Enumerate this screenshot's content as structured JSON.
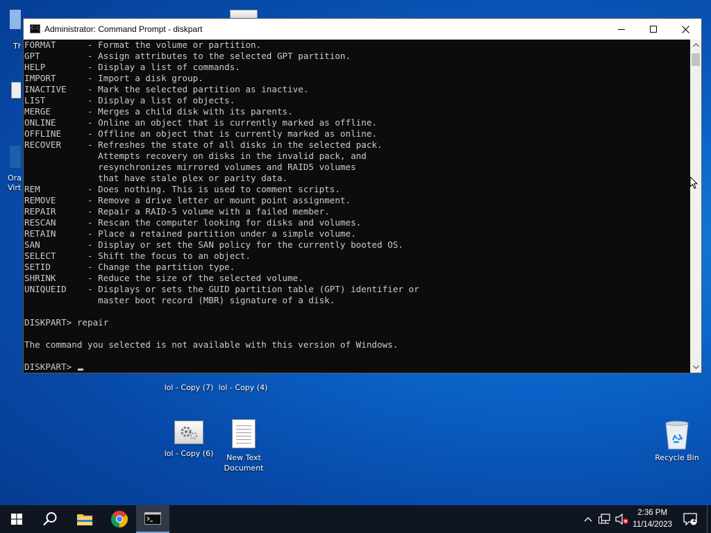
{
  "window": {
    "title": "Administrator: Command Prompt - diskpart",
    "icon_text": "C:\\_"
  },
  "console": {
    "lines": [
      "FORMAT      - Format the volume or partition.",
      "GPT         - Assign attributes to the selected GPT partition.",
      "HELP        - Display a list of commands.",
      "IMPORT      - Import a disk group.",
      "INACTIVE    - Mark the selected partition as inactive.",
      "LIST        - Display a list of objects.",
      "MERGE       - Merges a child disk with its parents.",
      "ONLINE      - Online an object that is currently marked as offline.",
      "OFFLINE     - Offline an object that is currently marked as online.",
      "RECOVER     - Refreshes the state of all disks in the selected pack.",
      "              Attempts recovery on disks in the invalid pack, and",
      "              resynchronizes mirrored volumes and RAID5 volumes",
      "              that have stale plex or parity data.",
      "REM         - Does nothing. This is used to comment scripts.",
      "REMOVE      - Remove a drive letter or mount point assignment.",
      "REPAIR      - Repair a RAID-5 volume with a failed member.",
      "RESCAN      - Rescan the computer looking for disks and volumes.",
      "RETAIN      - Place a retained partition under a simple volume.",
      "SAN         - Display or set the SAN policy for the currently booted OS.",
      "SELECT      - Shift the focus to an object.",
      "SETID       - Change the partition type.",
      "SHRINK      - Reduce the size of the selected volume.",
      "UNIQUEID    - Displays or sets the GUID partition table (GPT) identifier or",
      "              master boot record (MBR) signature of a disk.",
      "",
      "DISKPART> repair",
      "",
      "The command you selected is not available with this version of Windows.",
      ""
    ],
    "prompt": "DISKPART> "
  },
  "desktop": {
    "icons": [
      {
        "label": "lol - Copy (7)",
        "type": "settings-file"
      },
      {
        "label": "lol - Copy (4)",
        "type": "settings-file"
      },
      {
        "label": "lol - Copy (6)",
        "type": "settings-file"
      },
      {
        "label": "New Text Document",
        "type": "text-document"
      },
      {
        "label": "Recycle Bin",
        "type": "recycle-bin"
      }
    ],
    "partial_labels": [
      "Th",
      "Orac",
      "Virtu"
    ]
  },
  "taskbar": {
    "apps": [
      "start",
      "search",
      "file-explorer",
      "chrome",
      "command-prompt"
    ],
    "time": "2:36 PM",
    "date": "11/14/2023",
    "notification_count": "1"
  },
  "colors": {
    "console_bg": "#0c0c0c",
    "console_fg": "#cccccc",
    "taskbar": "#101621",
    "desktop": "#0a63c8"
  }
}
